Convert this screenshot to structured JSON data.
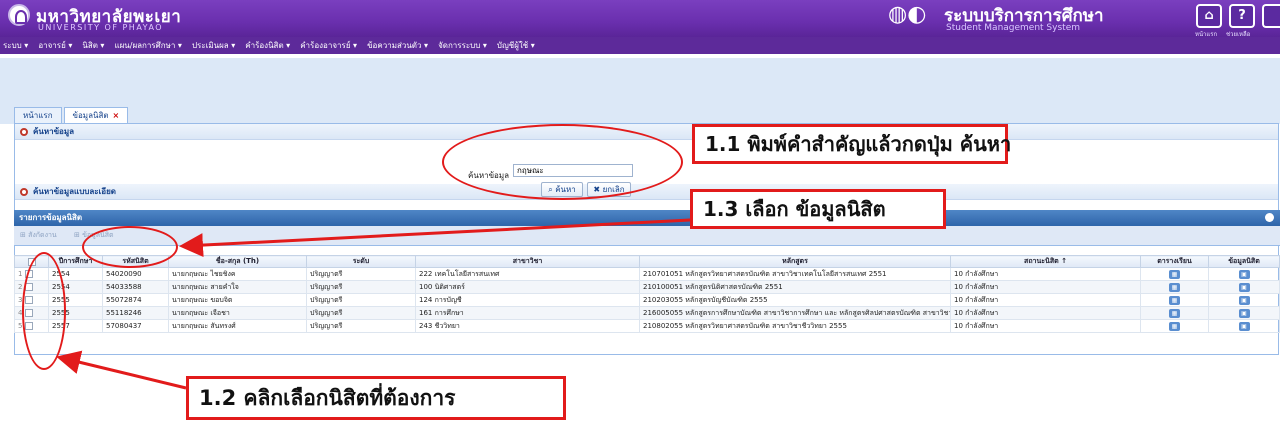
{
  "header": {
    "uni_th": "มหาวิทยาลัยพะเยา",
    "uni_en": "UNIVERSITY OF PHAYAO",
    "sys_th": "ระบบบริการการศึกษา",
    "sys_en": "Student Management System",
    "home_caption": "หน้าแรก",
    "help_caption": "ช่วยเหลือ",
    "home_icon": "home-icon",
    "help_glyph": "?"
  },
  "menu": [
    "ระบบ ▾",
    "อาจารย์ ▾",
    "นิสิต ▾",
    "แผน/ผลการศึกษา ▾",
    "ประเมินผล ▾",
    "คำร้องนิสิต ▾",
    "คำร้องอาจารย์ ▾",
    "ข้อความส่วนตัว ▾",
    "จัดการระบบ ▾",
    "บัญชีผู้ใช้ ▾"
  ],
  "tabs": [
    {
      "label": "หน้าแรก"
    },
    {
      "label": "ข้อมูลนิสิต",
      "close": "×"
    }
  ],
  "search": {
    "panel_title": "ค้นหาข้อมูล",
    "label": "ค้นหาข้อมูล",
    "value": "กฤษณะ",
    "search_btn": "⌕ ค้นหา",
    "clear_btn": "✖ ยกเลิก",
    "advanced_title": "ค้นหาข้อมูลแบบละเอียด"
  },
  "grid": {
    "title": "รายการข้อมูลนิสิต",
    "toolbar": [
      "⊞ สังกัดงาน",
      "⊞ ข้อมูลนิสิต"
    ],
    "columns": [
      "",
      "ปีการศึกษา",
      "รหัสนิสิต",
      "ชื่อ-สกุล (Th)",
      "ระดับ",
      "สาขาวิชา",
      "หลักสูตร",
      "สถานะนิสิต ↑",
      "ตารางเรียน",
      "ข้อมูลนิสิต"
    ],
    "rows": [
      {
        "n": "1",
        "year": "2554",
        "id": "54020090",
        "name": "นายกฤษณะ ไชยชิงค",
        "level": "ปริญญาตรี",
        "major": "222 เทคโนโลยีสารสนเทศ",
        "curr": "210701051 หลักสูตรวิทยาศาสตรบัณฑิต สาขาวิชาเทคโนโลยีสารสนเทศ 2551",
        "status": "10 กำลังศึกษา"
      },
      {
        "n": "2",
        "year": "2554",
        "id": "54033588",
        "name": "นายกฤษณะ สายคำใจ",
        "level": "ปริญญาตรี",
        "major": "100 นิติศาสตร์",
        "curr": "210100051 หลักสูตรนิติศาสตรบัณฑิต 2551",
        "status": "10 กำลังศึกษา"
      },
      {
        "n": "3",
        "year": "2555",
        "id": "55072874",
        "name": "นายกฤษณะ ขอบจิต",
        "level": "ปริญญาตรี",
        "major": "124 การบัญชี",
        "curr": "210203055 หลักสูตรบัญชีบัณฑิต 2555",
        "status": "10 กำลังศึกษา"
      },
      {
        "n": "4",
        "year": "2555",
        "id": "55118246",
        "name": "นายกฤษณะ เจือชา",
        "level": "ปริญญาตรี",
        "major": "161 การศึกษา",
        "curr": "216005055 หลักสูตรการศึกษาบัณฑิต สาขาวิชาการศึกษา และ หลักสูตรศิลปศาสตรบัณฑิต สาขาวิชาภ",
        "status": "10 กำลังศึกษา"
      },
      {
        "n": "5",
        "year": "2557",
        "id": "57080437",
        "name": "นายกฤษณะ สันทรงศ์",
        "level": "ปริญญาตรี",
        "major": "243 ชีววิทยา",
        "curr": "210802055 หลักสูตรวิทยาศาสตรบัณฑิต สาขาวิชาชีววิทยา 2555",
        "status": "10 กำลังศึกษา"
      }
    ]
  },
  "callouts": {
    "c1": "1.1 พิมพ์คำสำคัญแล้วกดปุ่ม ค้นหา",
    "c2": "1.3 เลือก ข้อมูลนิสิต",
    "c3": "1.2 คลิกเลือกนิสิตที่ต้องการ"
  },
  "colors": {
    "annotation": "#e21b1b",
    "header": "#6a2fae",
    "grid_header": "#2e65aa"
  }
}
